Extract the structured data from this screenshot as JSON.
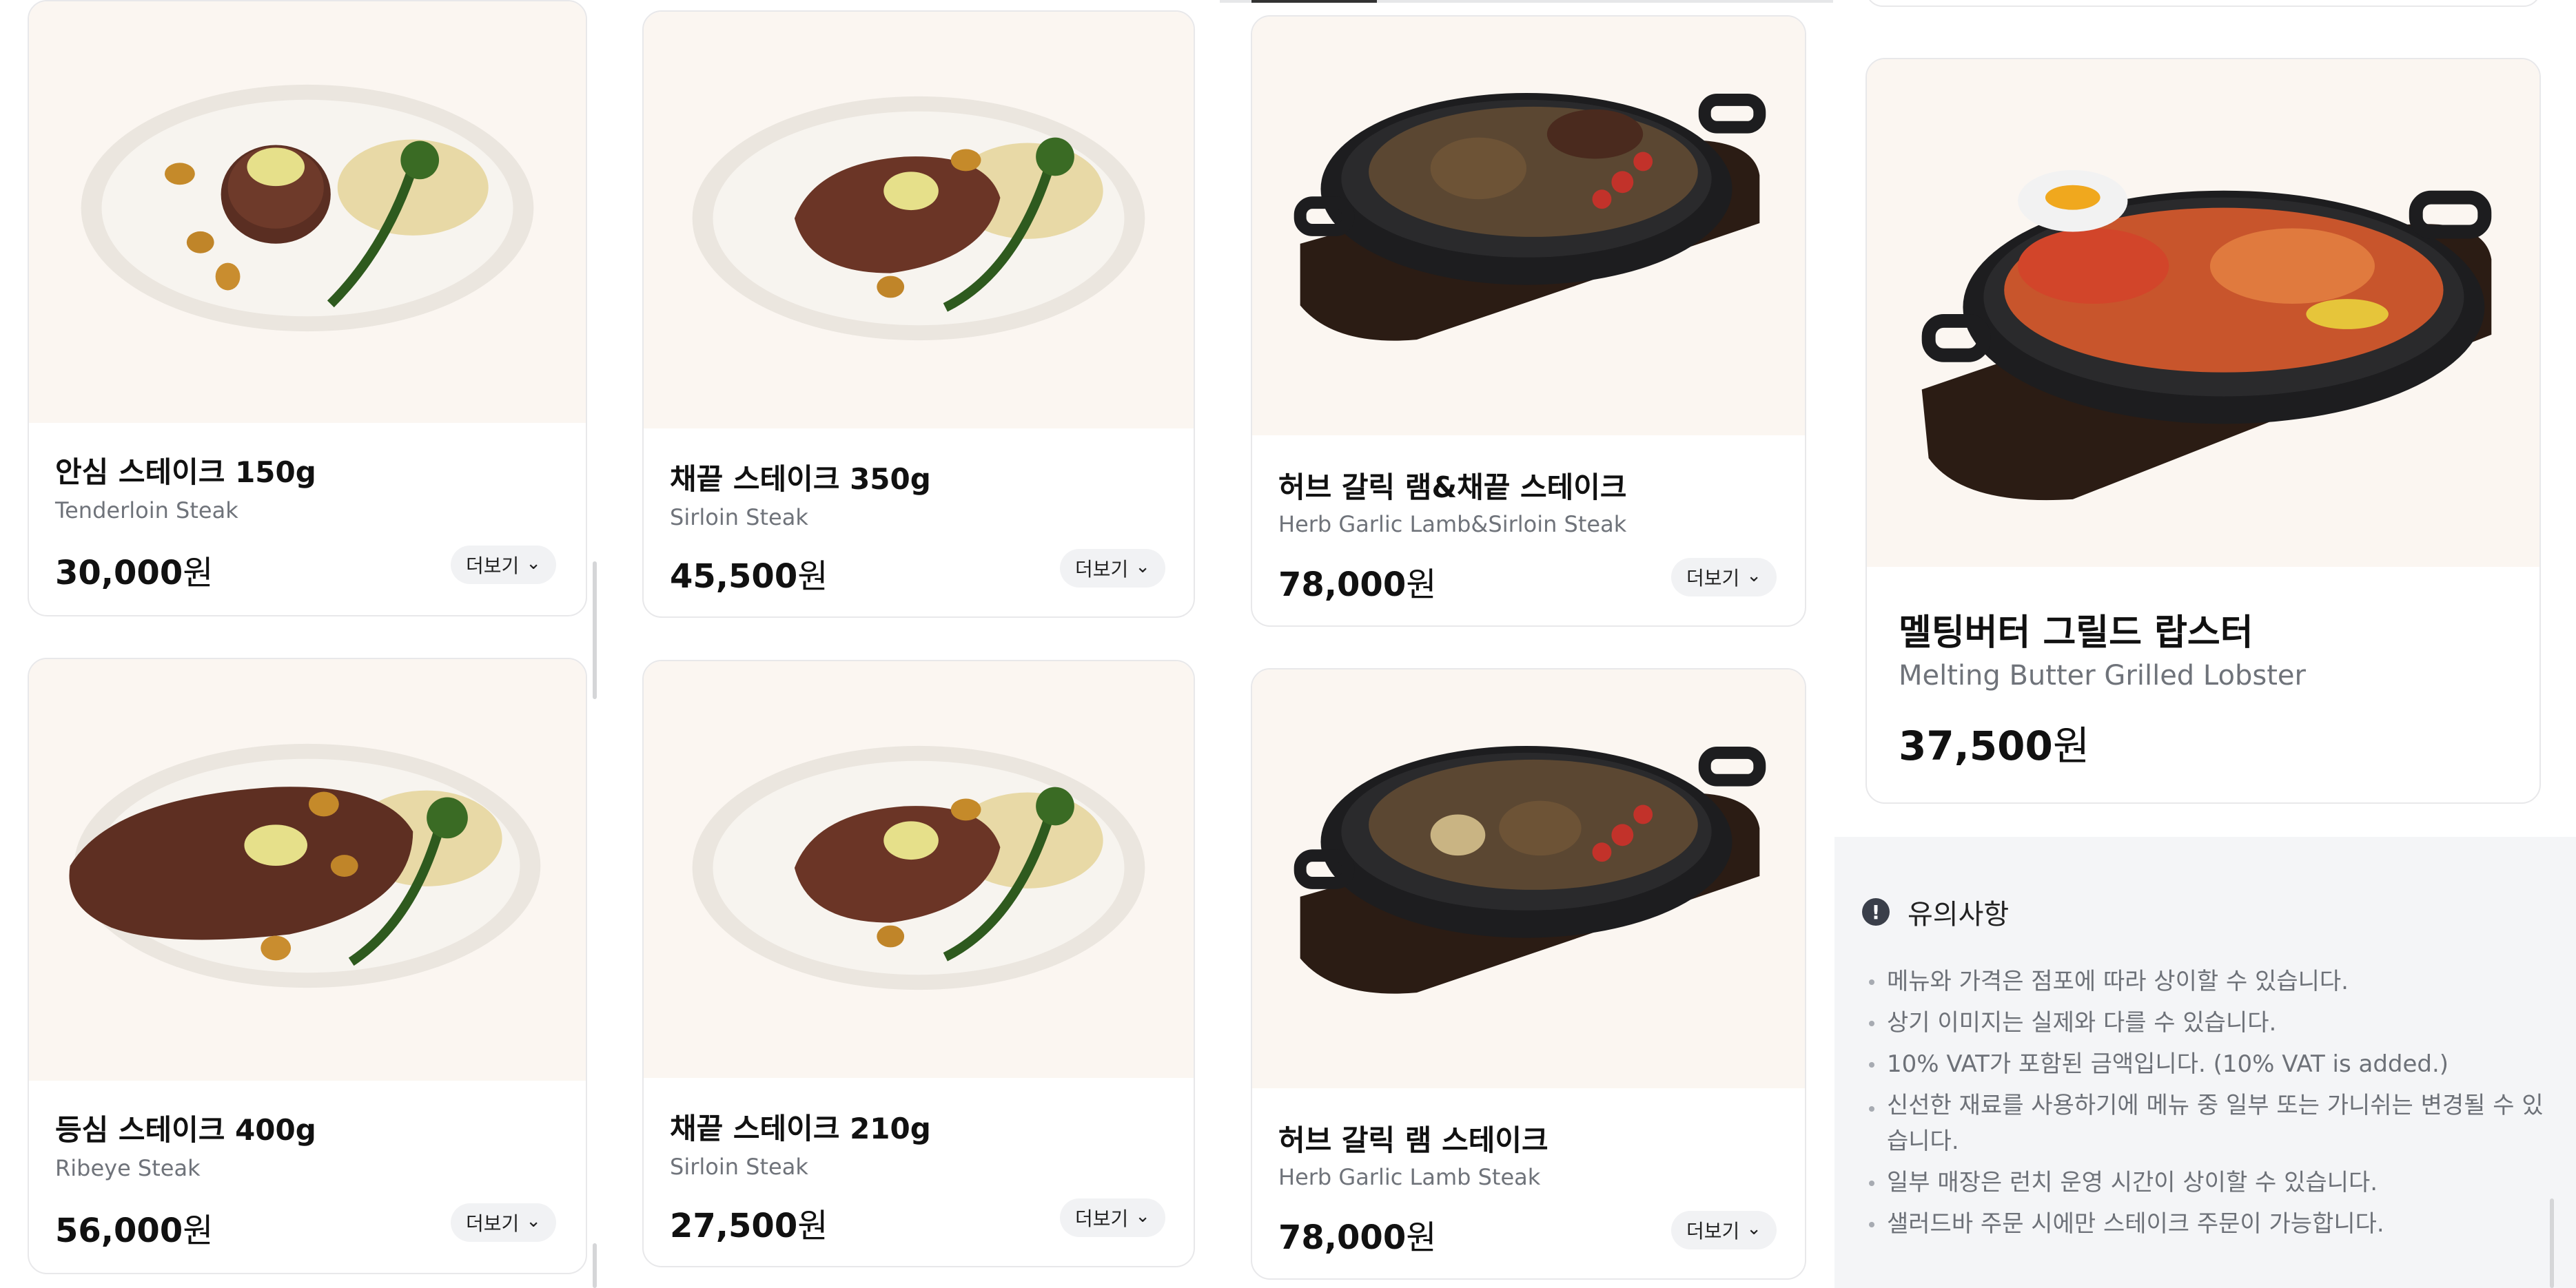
{
  "menu": [
    {
      "name": "안심 스테이크 150g",
      "sub": "Tenderloin Steak",
      "price": "30,000",
      "unit": "원",
      "more": "더보기"
    },
    {
      "name": "등심 스테이크 400g",
      "sub": "Ribeye Steak",
      "price": "56,000",
      "unit": "원",
      "more": "더보기"
    },
    {
      "name": "채끝 스테이크 350g",
      "sub": "Sirloin Steak",
      "price": "45,500",
      "unit": "원",
      "more": "더보기"
    },
    {
      "name": "채끝 스테이크 210g",
      "sub": "Sirloin Steak",
      "price": "27,500",
      "unit": "원",
      "more": "더보기"
    },
    {
      "name": "허브 갈릭 램&채끝 스테이크",
      "sub": "Herb Garlic Lamb&Sirloin Steak",
      "price": "78,000",
      "unit": "원",
      "more": "더보기"
    },
    {
      "name": "허브 갈릭 램 스테이크",
      "sub": "Herb Garlic Lamb Steak",
      "price": "78,000",
      "unit": "원",
      "more": "더보기"
    },
    {
      "name": "멜팅버터 그릴드 랍스터",
      "sub": "Melting Butter Grilled Lobster",
      "price": "37,500",
      "unit": "원"
    }
  ],
  "notice": {
    "title": "유의사항",
    "icon": "!",
    "items": [
      "메뉴와 가격은 점포에 따라 상이할 수 있습니다.",
      "상기 이미지는 실제와 다를 수 있습니다.",
      "10% VAT가 포함된 금액입니다. (10% VAT is added.)",
      "신선한 재료를 사용하기에 메뉴 중 일부 또는 가니쉬는 변경될 수 있습니다.",
      "일부 매장은 런치 운영 시간이 상이할 수 있습니다.",
      "샐러드바 주문 시에만 스테이크 주문이 가능합니다."
    ]
  },
  "colors": {
    "image_bg": "#fbf6f1",
    "card_border": "#e8e8ea",
    "notice_bg": "#f4f5f7",
    "muted_text": "#6f737a"
  }
}
